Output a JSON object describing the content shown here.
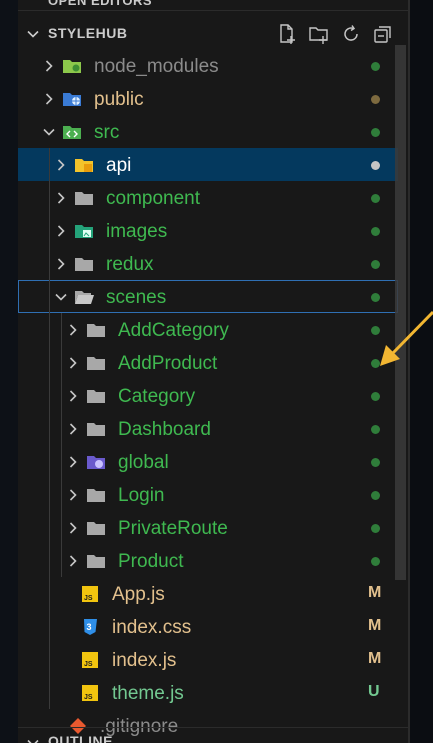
{
  "explorer": {
    "open_editors_label": "OPEN EDITORS",
    "root_label": "STYLEHUB",
    "outline_label": "OUTLINE",
    "actions": [
      "new-file-icon",
      "new-folder-icon",
      "refresh-icon",
      "collapse-all-icon"
    ]
  },
  "tree": [
    {
      "label": "node_modules",
      "depth": 0,
      "type": "folder",
      "expanded": false,
      "icon": "node-folder-icon",
      "color": "gray",
      "status": "dot",
      "status_color": ""
    },
    {
      "label": "public",
      "depth": 0,
      "type": "folder",
      "expanded": false,
      "icon": "public-folder-icon",
      "color": "yellow",
      "status": "dot",
      "status_color": "#7d6a3f"
    },
    {
      "label": "src",
      "depth": 0,
      "type": "folder",
      "expanded": true,
      "icon": "src-folder-icon",
      "color": "green",
      "status": "dot",
      "status_color": "#2f7d3a"
    },
    {
      "label": "api",
      "depth": 1,
      "type": "folder",
      "expanded": false,
      "icon": "api-folder-icon",
      "color": "white",
      "status": "dot",
      "status_color": "#c5c5c5",
      "selected": true
    },
    {
      "label": "component",
      "depth": 1,
      "type": "folder",
      "expanded": false,
      "icon": "folder-icon",
      "color": "green",
      "status": "dot",
      "status_color": "#2f7d3a"
    },
    {
      "label": "images",
      "depth": 1,
      "type": "folder",
      "expanded": false,
      "icon": "images-folder-icon",
      "color": "green",
      "status": "dot",
      "status_color": "#2f7d3a"
    },
    {
      "label": "redux",
      "depth": 1,
      "type": "folder",
      "expanded": false,
      "icon": "folder-icon",
      "color": "green",
      "status": "dot",
      "status_color": "#2f7d3a"
    },
    {
      "label": "scenes",
      "depth": 1,
      "type": "folder",
      "expanded": true,
      "icon": "folder-open-icon",
      "color": "green",
      "status": "dot",
      "status_color": "#2f7d3a",
      "focused": true
    },
    {
      "label": "AddCategory",
      "depth": 2,
      "type": "folder",
      "expanded": false,
      "icon": "folder-icon",
      "color": "green",
      "status": "dot",
      "status_color": "#2f7d3a"
    },
    {
      "label": "AddProduct",
      "depth": 2,
      "type": "folder",
      "expanded": false,
      "icon": "folder-icon",
      "color": "green",
      "status": "dot",
      "status_color": "#2f7d3a"
    },
    {
      "label": "Category",
      "depth": 2,
      "type": "folder",
      "expanded": false,
      "icon": "folder-icon",
      "color": "green",
      "status": "dot",
      "status_color": "#2f7d3a"
    },
    {
      "label": "Dashboard",
      "depth": 2,
      "type": "folder",
      "expanded": false,
      "icon": "folder-icon",
      "color": "green",
      "status": "dot",
      "status_color": "#2f7d3a"
    },
    {
      "label": "global",
      "depth": 2,
      "type": "folder",
      "expanded": false,
      "icon": "global-folder-icon",
      "color": "green",
      "status": "dot",
      "status_color": "#2f7d3a"
    },
    {
      "label": "Login",
      "depth": 2,
      "type": "folder",
      "expanded": false,
      "icon": "folder-icon",
      "color": "green",
      "status": "dot",
      "status_color": "#2f7d3a"
    },
    {
      "label": "PrivateRoute",
      "depth": 2,
      "type": "folder",
      "expanded": false,
      "icon": "folder-icon",
      "color": "green",
      "status": "dot",
      "status_color": "#2f7d3a"
    },
    {
      "label": "Product",
      "depth": 2,
      "type": "folder",
      "expanded": false,
      "icon": "folder-icon",
      "color": "green",
      "status": "dot",
      "status_color": "#2f7d3a"
    },
    {
      "label": "App.js",
      "depth": 1,
      "type": "file",
      "icon": "js-file-icon",
      "color": "yellow",
      "status": "badge",
      "badge": "M",
      "status_color": "#e2c08d"
    },
    {
      "label": "index.css",
      "depth": 1,
      "type": "file",
      "icon": "css-file-icon",
      "color": "yellow",
      "status": "badge",
      "badge": "M",
      "status_color": "#e2c08d"
    },
    {
      "label": "index.js",
      "depth": 1,
      "type": "file",
      "icon": "js-file-icon",
      "color": "yellow",
      "status": "badge",
      "badge": "M",
      "status_color": "#e2c08d"
    },
    {
      "label": "theme.js",
      "depth": 1,
      "type": "file",
      "icon": "js-file-icon",
      "color": "teal",
      "status": "badge",
      "badge": "U",
      "status_color": "#73c991"
    },
    {
      "label": ".gitignore",
      "depth": 0,
      "type": "file",
      "icon": "git-file-icon",
      "color": "gray",
      "status": "none"
    }
  ],
  "colors": {
    "selected_bg": "#04395e",
    "focus_border": "#2f6fb3",
    "annotation_arrow": "#f2b632"
  }
}
